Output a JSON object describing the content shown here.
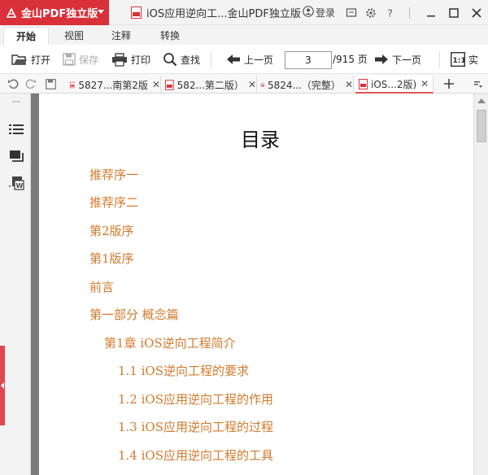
{
  "app": {
    "name": "金山PDF独立版",
    "doc_title": "iOS应用逆向工...金山PDF独立版"
  },
  "titlebar": {
    "login_label": "登录"
  },
  "menu": {
    "tabs": [
      "开始",
      "视图",
      "注释",
      "转换"
    ]
  },
  "toolbar": {
    "open": "打开",
    "save": "保存",
    "print": "打印",
    "find": "查找",
    "prev_page": "上一页",
    "current_page": "3",
    "total_pages": "/915 页",
    "next_page": "下一页",
    "overflow": "实"
  },
  "tabs": [
    {
      "label": "5827...南第2版",
      "active": false
    },
    {
      "label": "582...第二版）",
      "active": false
    },
    {
      "label": "5824...（完整）",
      "active": false
    },
    {
      "label": "iOS...2版)",
      "active": true
    }
  ],
  "document": {
    "page_title": "目录",
    "toc": [
      {
        "text": "推荐序一",
        "level": 0
      },
      {
        "text": "推荐序二",
        "level": 0
      },
      {
        "text": "第2版序",
        "level": 0
      },
      {
        "text": "第1版序",
        "level": 0
      },
      {
        "text": "前言",
        "level": 0
      },
      {
        "text": "第一部分 概念篇",
        "level": 0
      },
      {
        "text": "第1章 iOS逆向工程简介",
        "level": 1
      },
      {
        "text": "1.1 iOS逆向工程的要求",
        "level": 2
      },
      {
        "text": "1.2 iOS应用逆向工程的作用",
        "level": 2
      },
      {
        "text": "1.3 iOS应用逆向工程的过程",
        "level": 2
      },
      {
        "text": "1.4 iOS应用逆向工程的工具",
        "level": 2
      }
    ]
  },
  "colors": {
    "brand": "#d9303a",
    "toc_link": "#d37a2c",
    "active_tab_underline": "#e05555"
  }
}
